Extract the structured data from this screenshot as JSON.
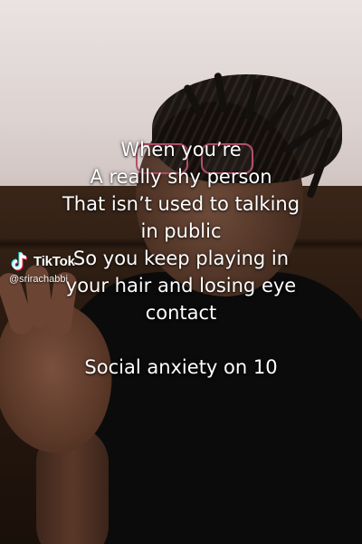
{
  "watermark": {
    "icon": "tiktok-logo-icon",
    "brand": "TikTok",
    "handle": "@srirachabbi"
  },
  "caption": {
    "lines": [
      "When you’re",
      "A really shy person",
      "That isn’t used to talking",
      "in public",
      "So you keep playing in",
      "your hair and losing eye",
      "contact"
    ],
    "footer": "Social anxiety on 10"
  },
  "colors": {
    "caption_text": "#ffffff",
    "tiktok_cyan": "#25f4ee",
    "tiktok_red": "#fe2c55"
  }
}
